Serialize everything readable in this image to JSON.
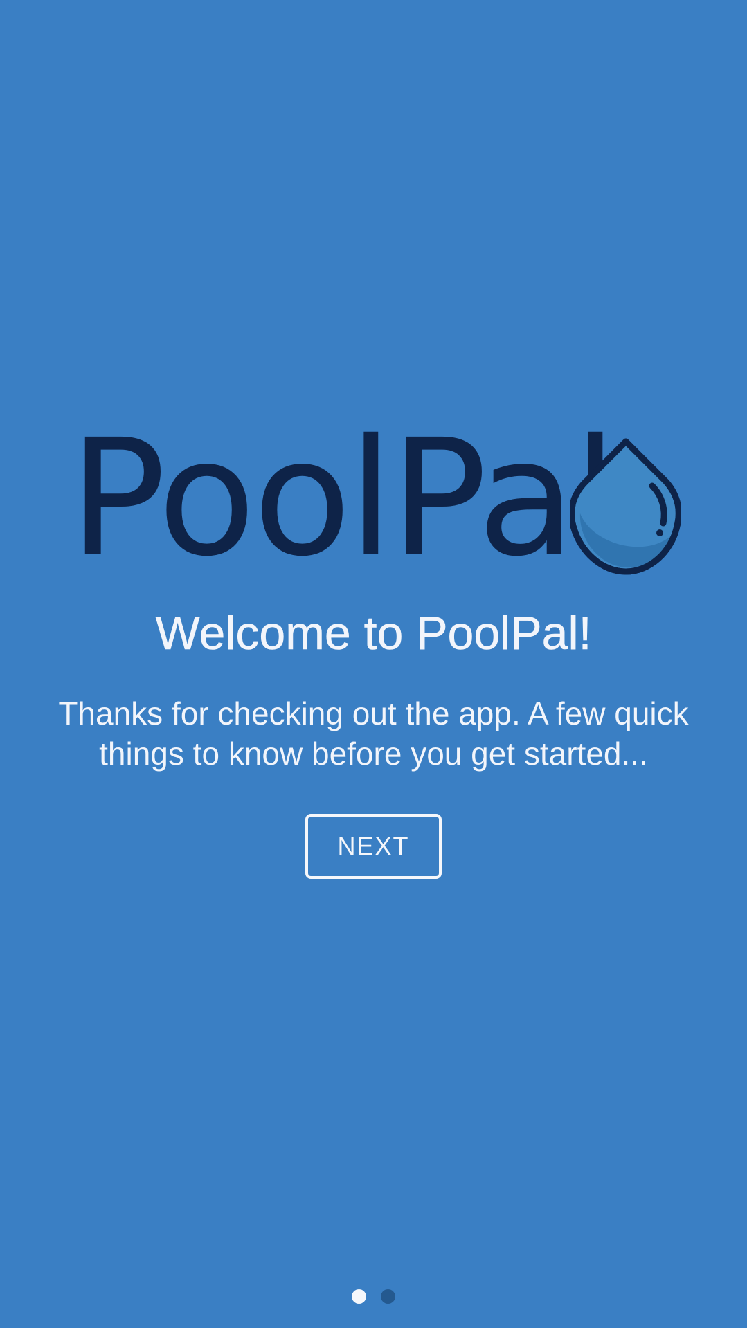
{
  "app": {
    "logo_text": "PoolPal",
    "logo_icon": "water-drop-icon"
  },
  "welcome": {
    "title": "Welcome to PoolPal!",
    "message": "Thanks for checking out the app. A few quick things to know before you get started...",
    "next_label": "NEXT"
  },
  "pager": {
    "current_page": 1,
    "total_pages": 2
  },
  "colors": {
    "background": "#3a7fc4",
    "logo_dark": "#0e2348",
    "drop_fill": "#3f88c5",
    "drop_shade": "#2f73ad",
    "text": "#f2f5fb",
    "dot_active": "#f5f7fb",
    "dot_inactive": "#24598f"
  }
}
